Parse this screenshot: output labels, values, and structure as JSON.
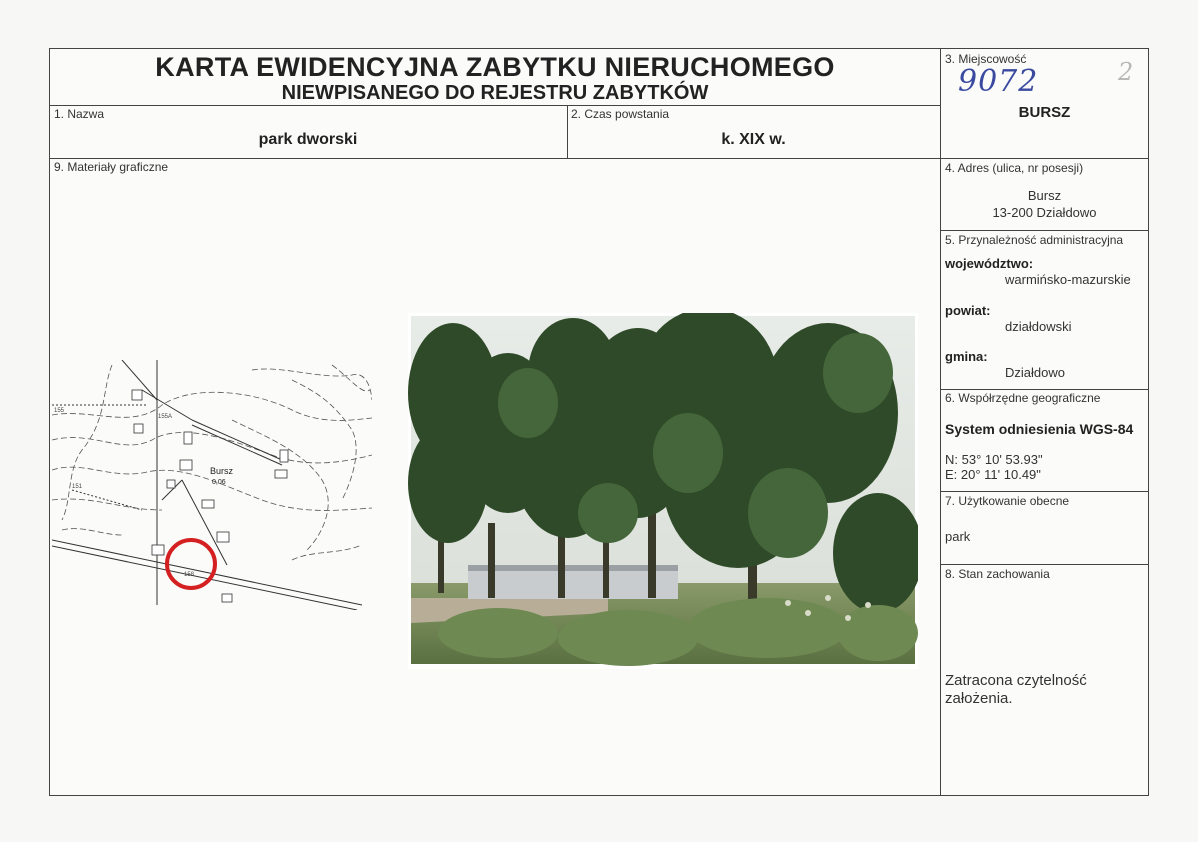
{
  "header": {
    "title_line1": "KARTA EWIDENCYJNA ZABYTKU NIERUCHOMEGO",
    "title_line2": "NIEWPISANEGO DO REJESTRU ZABYTKÓW"
  },
  "fields": {
    "name": {
      "label": "1. Nazwa",
      "value": "park dworski"
    },
    "period": {
      "label": "2. Czas powstania",
      "value": "k. XIX w."
    },
    "locality": {
      "label": "3. Miejscowość",
      "value": "BURSZ",
      "handwritten_number": "9072",
      "handwritten_page": "2"
    },
    "address": {
      "label": "4. Adres (ulica, nr posesji)",
      "line1": "Bursz",
      "line2": "13-200 Działdowo"
    },
    "admin": {
      "label": "5. Przynależność administracyjna",
      "voivodeship_label": "województwo:",
      "voivodeship": "warmińsko-mazurskie",
      "county_label": "powiat:",
      "county": "działdowski",
      "commune_label": "gmina:",
      "commune": "Działdowo"
    },
    "coordinates": {
      "label": "6. Współrzędne geograficzne",
      "system": "System odniesienia WGS-84",
      "north": "N: 53° 10' 53.93\"",
      "east": "E: 20° 11' 10.49\""
    },
    "usage": {
      "label": "7. Użytkowanie obecne",
      "value": "park"
    },
    "condition": {
      "label": "8. Stan zachowania",
      "value_line1": "Zatracona czytelność",
      "value_line2": "założenia."
    },
    "graphics": {
      "label": "9. Materiały graficzne"
    }
  },
  "map": {
    "place_label": "Bursz",
    "place_sub": "0,06",
    "labels": [
      "155",
      "155A",
      "151",
      "158"
    ]
  }
}
